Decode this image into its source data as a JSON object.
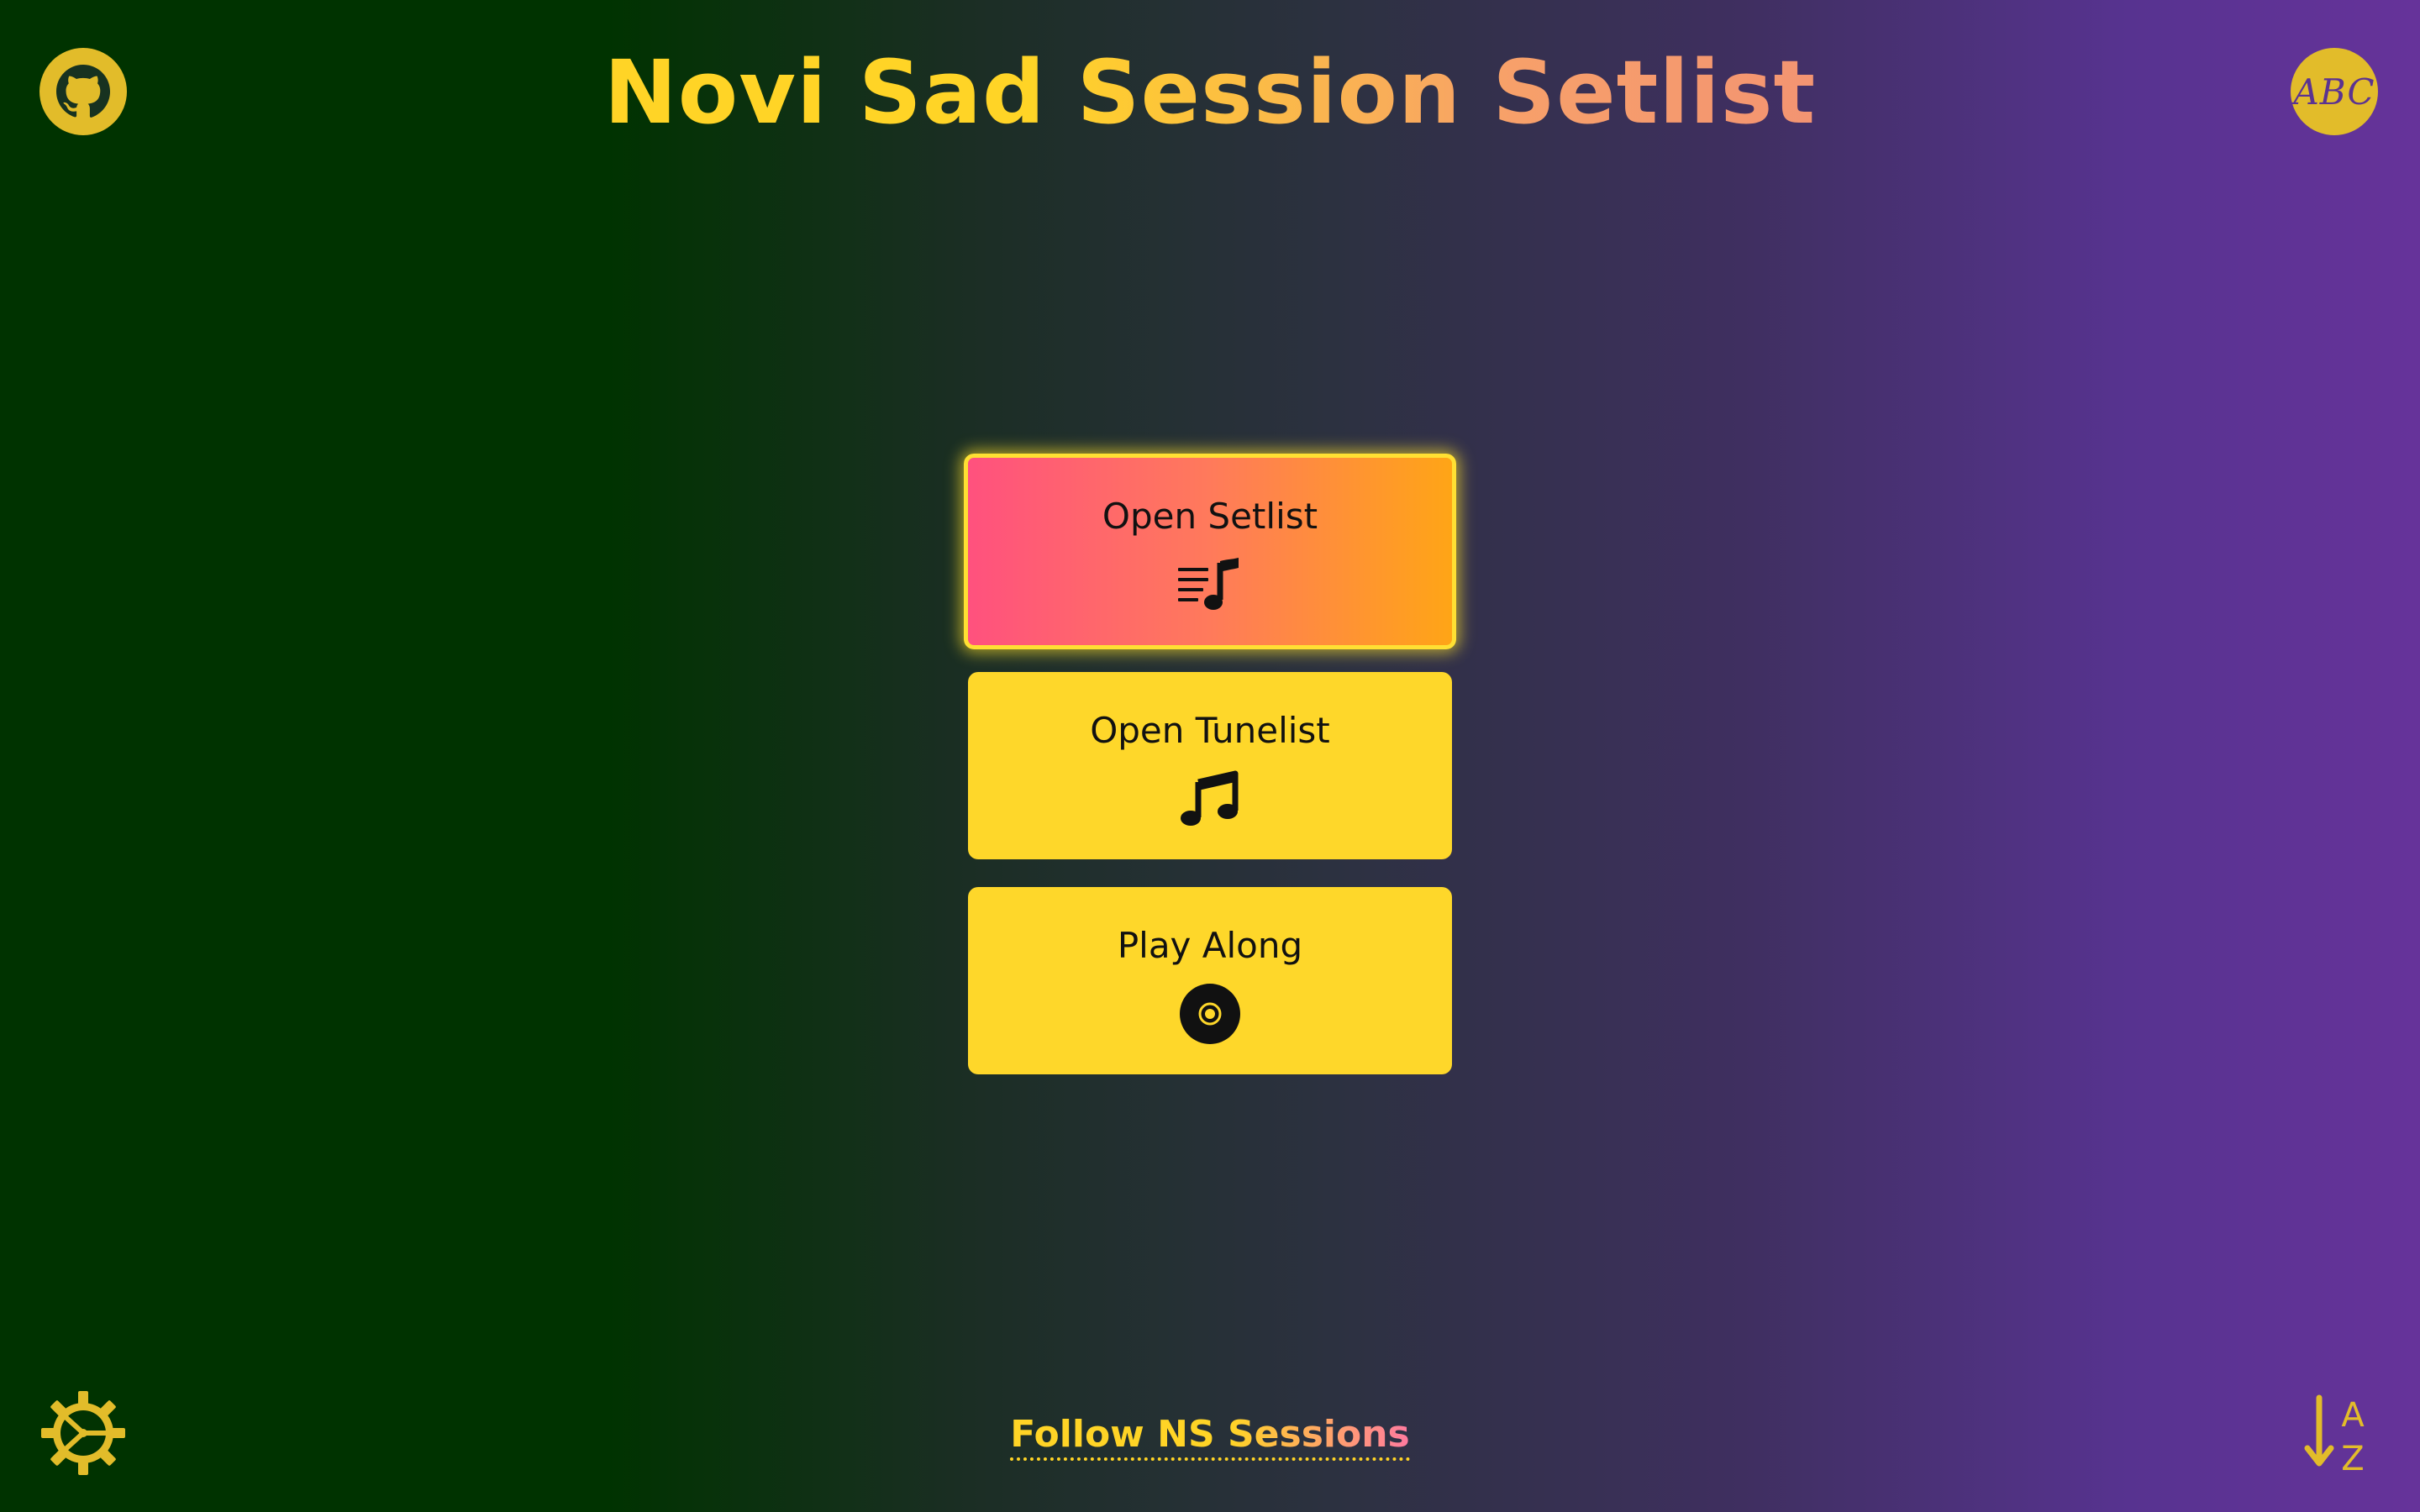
{
  "header": {
    "title": "Novi Sad Session Setlist",
    "abc_label": "ABC"
  },
  "menu": {
    "items": [
      {
        "label": "Open Setlist",
        "icon": "setlist-icon",
        "active": true
      },
      {
        "label": "Open Tunelist",
        "icon": "music-notes-icon",
        "active": false
      },
      {
        "label": "Play Along",
        "icon": "disc-icon",
        "active": false
      }
    ]
  },
  "footer": {
    "follow_label": "Follow NS Sessions",
    "sort_label_top": "A",
    "sort_label_bottom": "Z"
  },
  "colors": {
    "accent_yellow": "#fed72a",
    "active_start": "#ff517e",
    "active_end": "#ffa516",
    "background_left": "#003300",
    "background_right": "#66339a",
    "icon_gold": "#e2bc2a"
  },
  "icons": {
    "top_left": "github-icon",
    "top_right": "abc-notation-icon",
    "bottom_left": "settings-gear-icon",
    "bottom_right": "sort-a-z-icon"
  }
}
